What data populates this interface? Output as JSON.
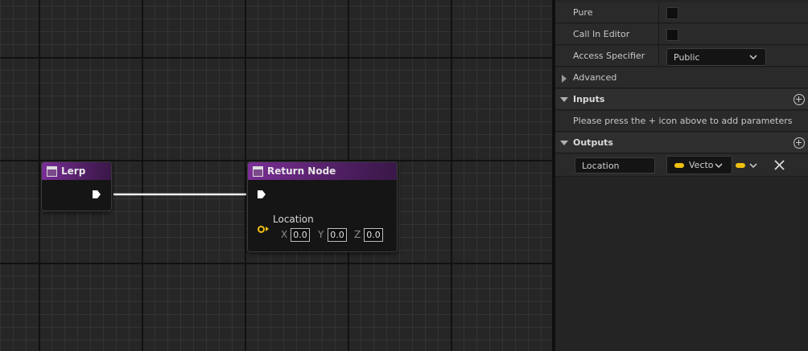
{
  "graph": {
    "lerp_node": {
      "title": "Lerp"
    },
    "return_node": {
      "title": "Return Node",
      "location_label": "Location",
      "x_label": "X",
      "x_value": "0.0",
      "y_label": "Y",
      "y_value": "0.0",
      "z_label": "Z",
      "z_value": "0.0"
    },
    "colors": {
      "header": "#7a2e96",
      "vector_pin": "#f0c010",
      "wire": "#ffffff"
    }
  },
  "details": {
    "pure_label": "Pure",
    "call_in_editor_label": "Call In Editor",
    "access_specifier_label": "Access Specifier",
    "access_specifier_value": "Public",
    "advanced_label": "Advanced",
    "inputs_label": "Inputs",
    "inputs_hint": "Please press the + icon above to add parameters",
    "outputs_label": "Outputs",
    "output_param": {
      "name": "Location",
      "type": "Vecto"
    }
  }
}
